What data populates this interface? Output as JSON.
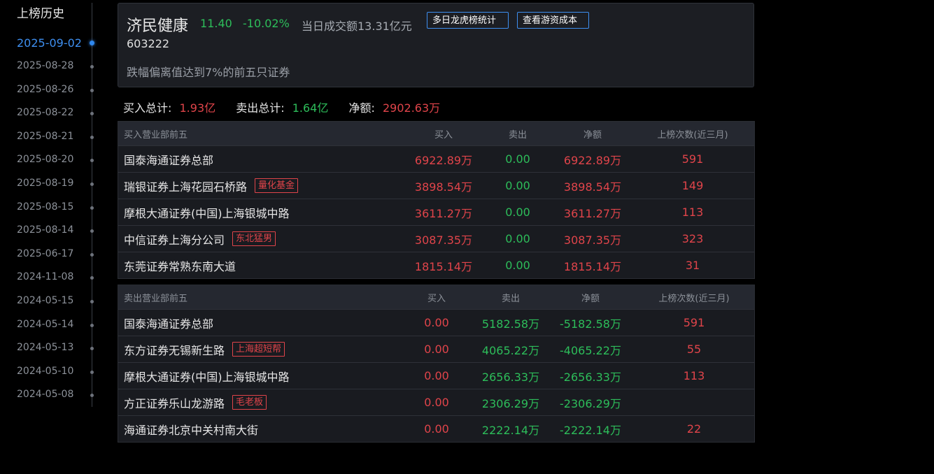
{
  "sidebar": {
    "title": "上榜历史",
    "dates": [
      "2025-09-02",
      "2025-08-28",
      "2025-08-26",
      "2025-08-22",
      "2025-08-21",
      "2025-08-20",
      "2025-08-19",
      "2025-08-15",
      "2025-08-14",
      "2025-06-17",
      "2024-11-08",
      "2024-05-15",
      "2024-05-14",
      "2024-05-13",
      "2024-05-10",
      "2024-05-08"
    ],
    "active_index": 0
  },
  "stock": {
    "name": "济民健康",
    "price": "11.40",
    "change_pct": "-10.02%",
    "turnover": "当日成交额13.31亿元",
    "code": "603222",
    "reason": "跌幅偏离值达到7%的前五只证券"
  },
  "buttons": {
    "multi_day": "多日龙虎榜统计",
    "hot_money_cost": "查看游资成本"
  },
  "totals": {
    "buy_label": "买入总计:",
    "buy_value": "1.93亿",
    "sell_label": "卖出总计:",
    "sell_value": "1.64亿",
    "net_label": "净额:",
    "net_value": "2902.63万"
  },
  "buy_table": {
    "headers": [
      "买入营业部前五",
      "买入",
      "卖出",
      "净额",
      "上榜次数(近三月)"
    ],
    "rows": [
      {
        "name": "国泰海通证券总部",
        "tag": "",
        "buy": "6922.89万",
        "sell": "0.00",
        "net": "6922.89万",
        "count": "591"
      },
      {
        "name": "瑞银证券上海花园石桥路",
        "tag": "量化基金",
        "buy": "3898.54万",
        "sell": "0.00",
        "net": "3898.54万",
        "count": "149"
      },
      {
        "name": "摩根大通证券(中国)上海银城中路",
        "tag": "",
        "buy": "3611.27万",
        "sell": "0.00",
        "net": "3611.27万",
        "count": "113"
      },
      {
        "name": "中信证券上海分公司",
        "tag": "东北猛男",
        "buy": "3087.35万",
        "sell": "0.00",
        "net": "3087.35万",
        "count": "323"
      },
      {
        "name": "东莞证券常熟东南大道",
        "tag": "",
        "buy": "1815.14万",
        "sell": "0.00",
        "net": "1815.14万",
        "count": "31"
      }
    ]
  },
  "sell_table": {
    "headers": [
      "卖出营业部前五",
      "买入",
      "卖出",
      "净额",
      "上榜次数(近三月)"
    ],
    "rows": [
      {
        "name": "国泰海通证券总部",
        "tag": "",
        "buy": "0.00",
        "sell": "5182.58万",
        "net": "-5182.58万",
        "count": "591"
      },
      {
        "name": "东方证券无锡新生路",
        "tag": "上海超短帮",
        "buy": "0.00",
        "sell": "4065.22万",
        "net": "-4065.22万",
        "count": "55"
      },
      {
        "name": "摩根大通证券(中国)上海银城中路",
        "tag": "",
        "buy": "0.00",
        "sell": "2656.33万",
        "net": "-2656.33万",
        "count": "113"
      },
      {
        "name": "方正证券乐山龙游路",
        "tag": "毛老板",
        "buy": "0.00",
        "sell": "2306.29万",
        "net": "-2306.29万",
        "count": ""
      },
      {
        "name": "海通证券北京中关村南大街",
        "tag": "",
        "buy": "0.00",
        "sell": "2222.14万",
        "net": "-2222.14万",
        "count": "22"
      }
    ]
  }
}
